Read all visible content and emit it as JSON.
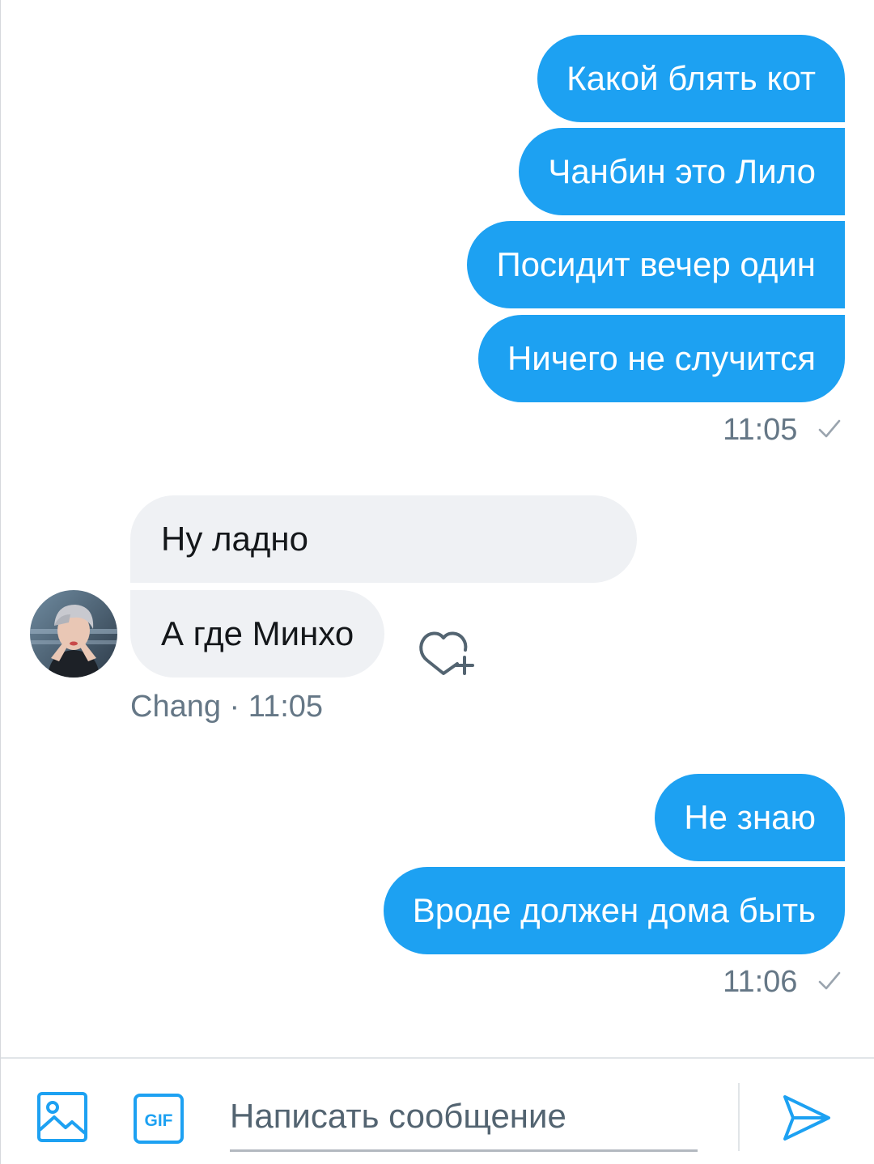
{
  "conversation": {
    "outgoing_group_1": {
      "messages": [
        "Какой блять кот",
        "Чанбин это Лило",
        "Посидит вечер один",
        "Ничего не случится"
      ],
      "time": "11:05"
    },
    "incoming_group": {
      "messages": [
        "Ну ладно",
        "А где Минхо"
      ],
      "meta": "Chang · 11:05"
    },
    "outgoing_group_2": {
      "messages": [
        "Не знаю",
        "Вроде должен дома быть"
      ],
      "time": "11:06"
    }
  },
  "composer": {
    "placeholder": "Написать сообщение",
    "gif_label": "GIF"
  },
  "colors": {
    "accent": "#1da1f2",
    "incoming_bubble": "#eff1f4",
    "meta_text": "#657786"
  },
  "icons": [
    "check-icon",
    "heart-plus-icon",
    "image-icon",
    "gif-icon",
    "send-icon",
    "avatar"
  ]
}
